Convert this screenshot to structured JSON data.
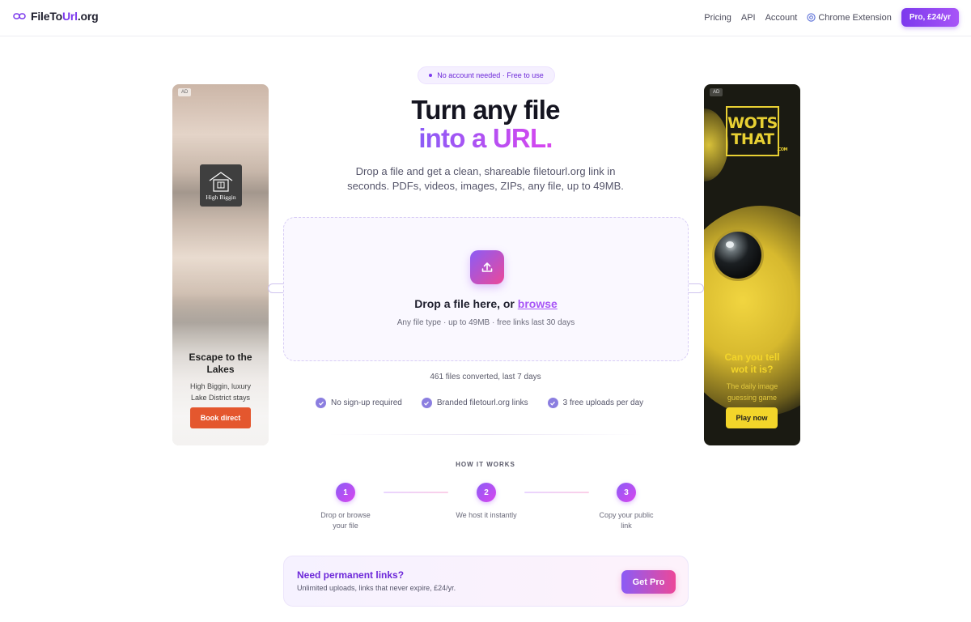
{
  "header": {
    "logo_text_a": "FileTo",
    "logo_text_b": "Url",
    "logo_text_c": ".org",
    "nav": {
      "pricing": "Pricing",
      "api": "API",
      "account": "Account",
      "chrome": "Chrome Extension",
      "pro": "Pro, £24/yr"
    }
  },
  "hero": {
    "badge": "No account needed · Free to use",
    "title_line1": "Turn any file",
    "title_line2": "into a URL.",
    "subtitle_line1": "Drop a file and get a clean, shareable filetourl.org link in",
    "subtitle_line2": "seconds. PDFs, videos, images, ZIPs, any file, up to 49MB."
  },
  "dropzone": {
    "title_prefix": "Drop a file here, or ",
    "browse": "browse",
    "sub": "Any file type · up to 49MB · free links last 30 days"
  },
  "stats": "461 files converted, last 7 days",
  "features": [
    "No sign-up required",
    "Branded filetourl.org links",
    "3 free uploads per day"
  ],
  "how": {
    "heading": "HOW IT WORKS",
    "steps": [
      {
        "num": "1",
        "line1": "Drop or browse",
        "line2": "your file"
      },
      {
        "num": "2",
        "line1": "We host it instantly",
        "line2": ""
      },
      {
        "num": "3",
        "line1": "Copy your public",
        "line2": "link"
      }
    ]
  },
  "cta": {
    "title": "Need permanent links?",
    "sub": "Unlimited uploads, links that never expire, £24/yr.",
    "button": "Get Pro"
  },
  "ad_left": {
    "tag": "AD",
    "brand": "High Biggin",
    "title_line1": "Escape to the",
    "title_line2": "Lakes",
    "desc_line1": "High Biggin, luxury",
    "desc_line2": "Lake District stays",
    "button": "Book direct"
  },
  "ad_right": {
    "tag": "AD",
    "logo_line1": "WOTS",
    "logo_line2": "THAT",
    "logo_suffix": ".COM",
    "title_line1": "Can you tell",
    "title_line2": "wot it is?",
    "desc_line1": "The daily image",
    "desc_line2": "guessing game",
    "button": "Play now"
  },
  "colors": {
    "brand": "#7c3aed",
    "accent_pink": "#ec4899",
    "ad_orange": "#e4572e",
    "ad_yellow": "#f3d52a"
  }
}
